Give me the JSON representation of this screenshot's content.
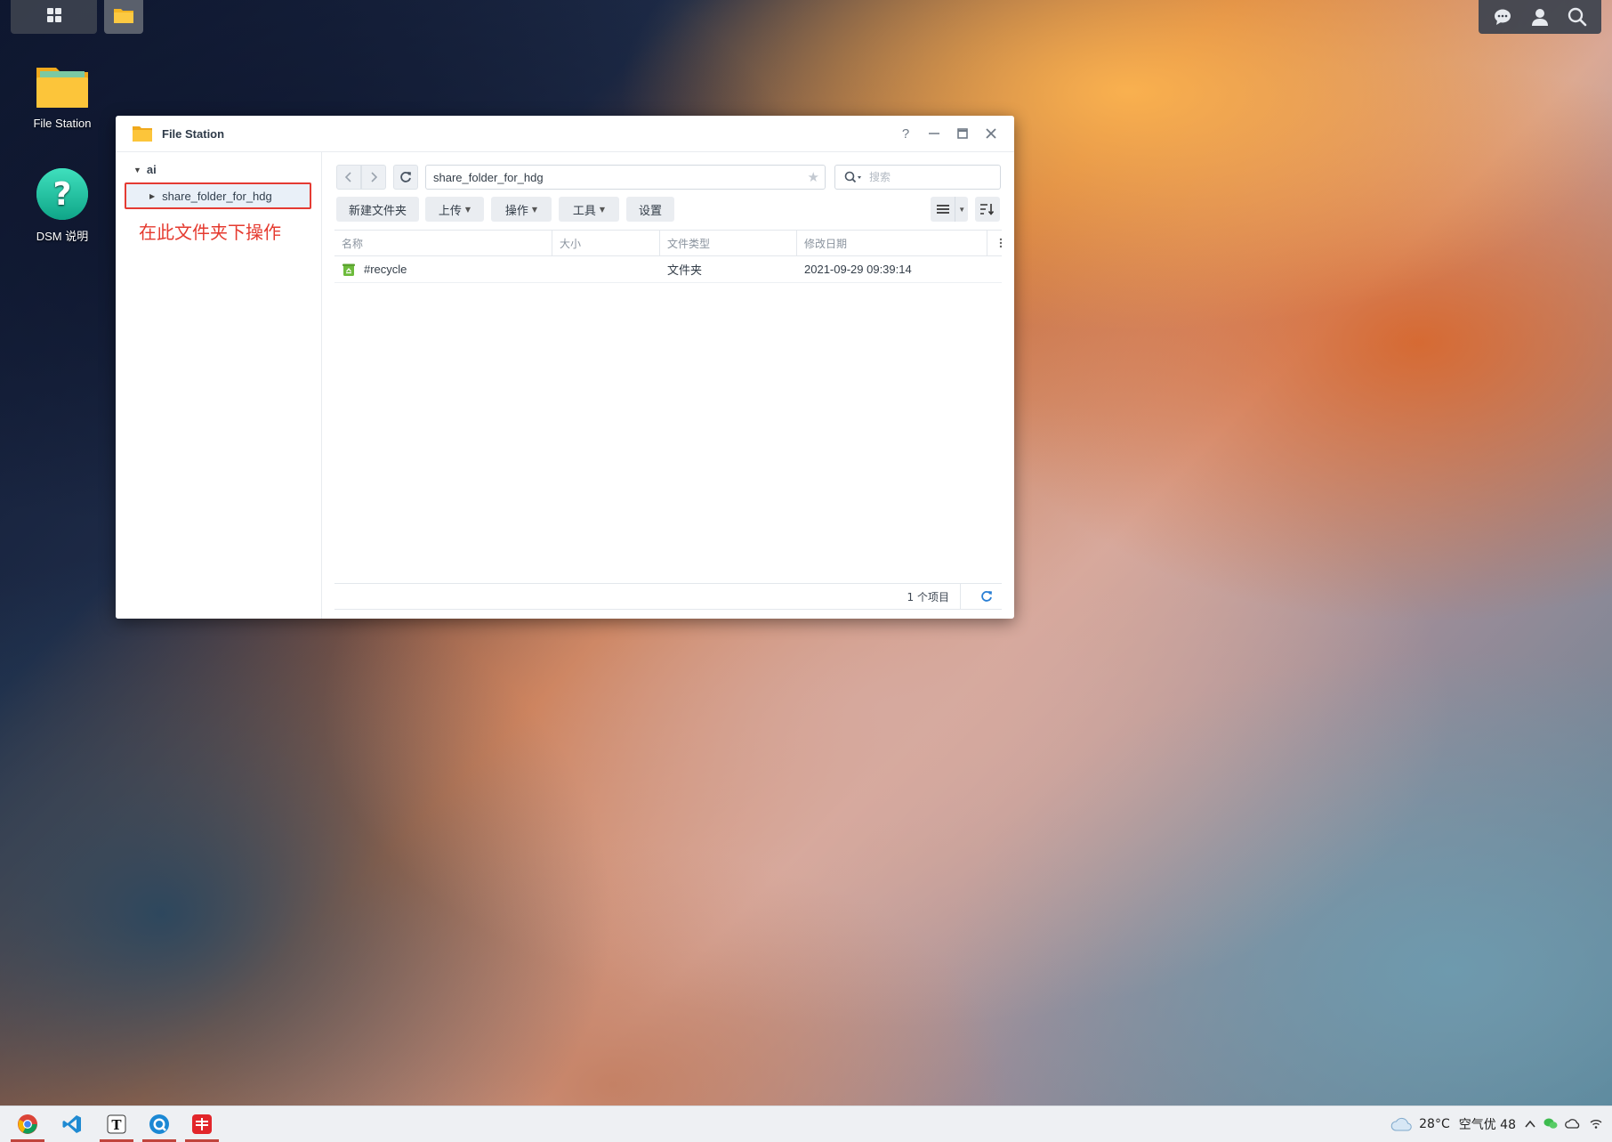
{
  "topbar": {
    "main_menu_icon": "grid-icon",
    "task_file_station_icon": "folder-icon",
    "tray": [
      "chat-icon",
      "user-icon",
      "search-icon"
    ]
  },
  "desktop": {
    "icons": [
      {
        "label": "File Station",
        "icon": "folder-icon"
      },
      {
        "label": "DSM 说明",
        "icon": "help-icon"
      }
    ]
  },
  "window": {
    "title": "File Station",
    "controls": {
      "help": "?",
      "minimize": "—",
      "maximize": "▭",
      "close": "✕"
    },
    "tree": {
      "root": "ai",
      "share": "share_folder_for_hdg",
      "annotation": "在此文件夹下操作"
    },
    "path": "share_folder_for_hdg",
    "search_placeholder": "搜索",
    "toolbar": {
      "new_folder": "新建文件夹",
      "upload": "上传",
      "action": "操作",
      "tools": "工具",
      "settings": "设置"
    },
    "columns": {
      "name": "名称",
      "size": "大小",
      "type": "文件类型",
      "modified": "修改日期"
    },
    "files": [
      {
        "name": "#recycle",
        "size": "",
        "type": "文件夹",
        "modified": "2021-09-29 09:39:14"
      }
    ],
    "status": "1 个项目"
  },
  "taskbar": {
    "apps": [
      "chrome-icon",
      "vscode-icon",
      "typora-icon",
      "qq-browser-icon",
      "youdao-icon"
    ],
    "temperature": "28°C",
    "air_quality": "空气优 48"
  },
  "colors": {
    "accent": "#2a7fd4",
    "annotation": "#e53a2f"
  }
}
